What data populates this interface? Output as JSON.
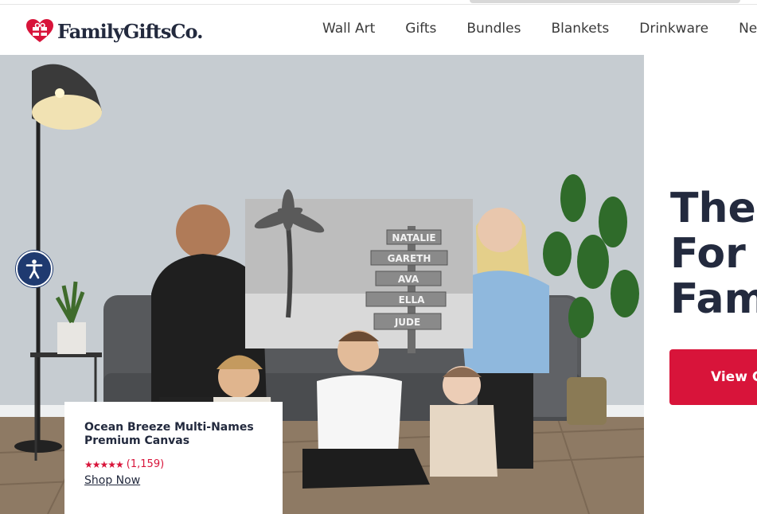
{
  "brand": {
    "name": "FamilyGiftsCo.",
    "accent": "#d8143a",
    "dark": "#232a3e"
  },
  "nav": {
    "items": [
      "Wall Art",
      "Gifts",
      "Bundles",
      "Blankets",
      "Drinkware",
      "Ne"
    ]
  },
  "hero": {
    "headline_lines": [
      "The",
      "For Y",
      "Fam"
    ],
    "cta_label": "View C",
    "canvas_names": [
      "NATALIE",
      "GARETH",
      "AVA",
      "ELLA",
      "JUDE"
    ]
  },
  "product_card": {
    "title": "Ocean Breeze Multi-Names Premium Canvas",
    "stars": "★★★★★",
    "review_count": "(1,159)",
    "link_label": "Shop Now"
  },
  "accessibility": {
    "icon": "accessibility-icon"
  }
}
